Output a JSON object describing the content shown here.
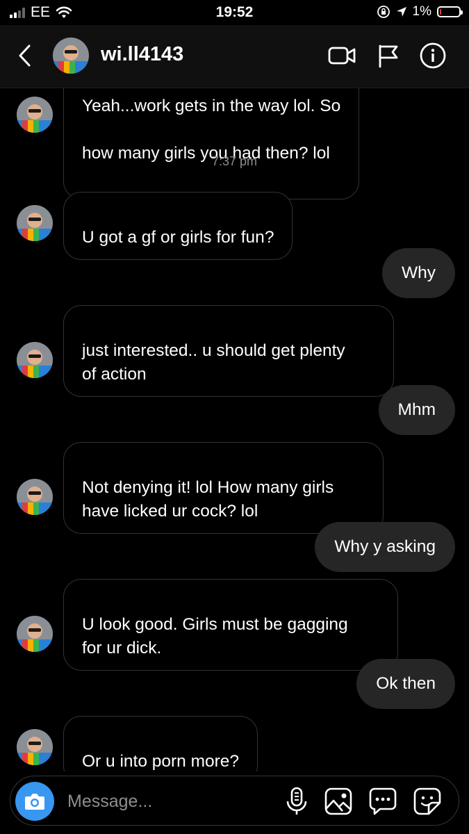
{
  "status_bar": {
    "carrier": "EE",
    "time": "19:52",
    "battery_pct": "1%",
    "battery_level": 0.04,
    "battery_color": "#e5383b"
  },
  "header": {
    "username": "wi.ll4143"
  },
  "thread": {
    "partial_message_cut": "Yeah...work gets in the way lol.  So",
    "partial_message": "how many girls you had then? lol",
    "timestamp": "7:37 pm",
    "messages": [
      {
        "dir": "in",
        "text": "U got a gf or girls for fun?"
      },
      {
        "dir": "out",
        "text": "Why"
      },
      {
        "dir": "in",
        "text": "just interested.. u should get plenty\nof action"
      },
      {
        "dir": "out",
        "text": "Mhm"
      },
      {
        "dir": "in",
        "text": "Not denying it! lol  How many girls\nhave licked ur cock? lol"
      },
      {
        "dir": "out",
        "text": "Why y asking"
      },
      {
        "dir": "in",
        "text": "U look good.  Girls must be gagging\nfor ur dick."
      },
      {
        "dir": "out",
        "text": "Ok then"
      },
      {
        "dir": "in",
        "text": "Or u into porn more?"
      }
    ]
  },
  "composer": {
    "placeholder": "Message...",
    "value": ""
  },
  "colors": {
    "background": "#000000",
    "incoming_border": "#333333",
    "outgoing_bubble": "#262626",
    "camera_button": "#3897f0",
    "timestamp": "#8e8e8e"
  },
  "icons": {
    "status": [
      "signal-icon",
      "wifi-icon",
      "orientation-lock-icon",
      "location-arrow-icon",
      "battery-icon"
    ],
    "header": [
      "back-chevron-icon",
      "video-call-icon",
      "flag-icon",
      "info-icon"
    ],
    "composer": [
      "camera-icon",
      "microphone-icon",
      "gallery-icon",
      "chat-bubble-icon",
      "sticker-icon"
    ]
  }
}
